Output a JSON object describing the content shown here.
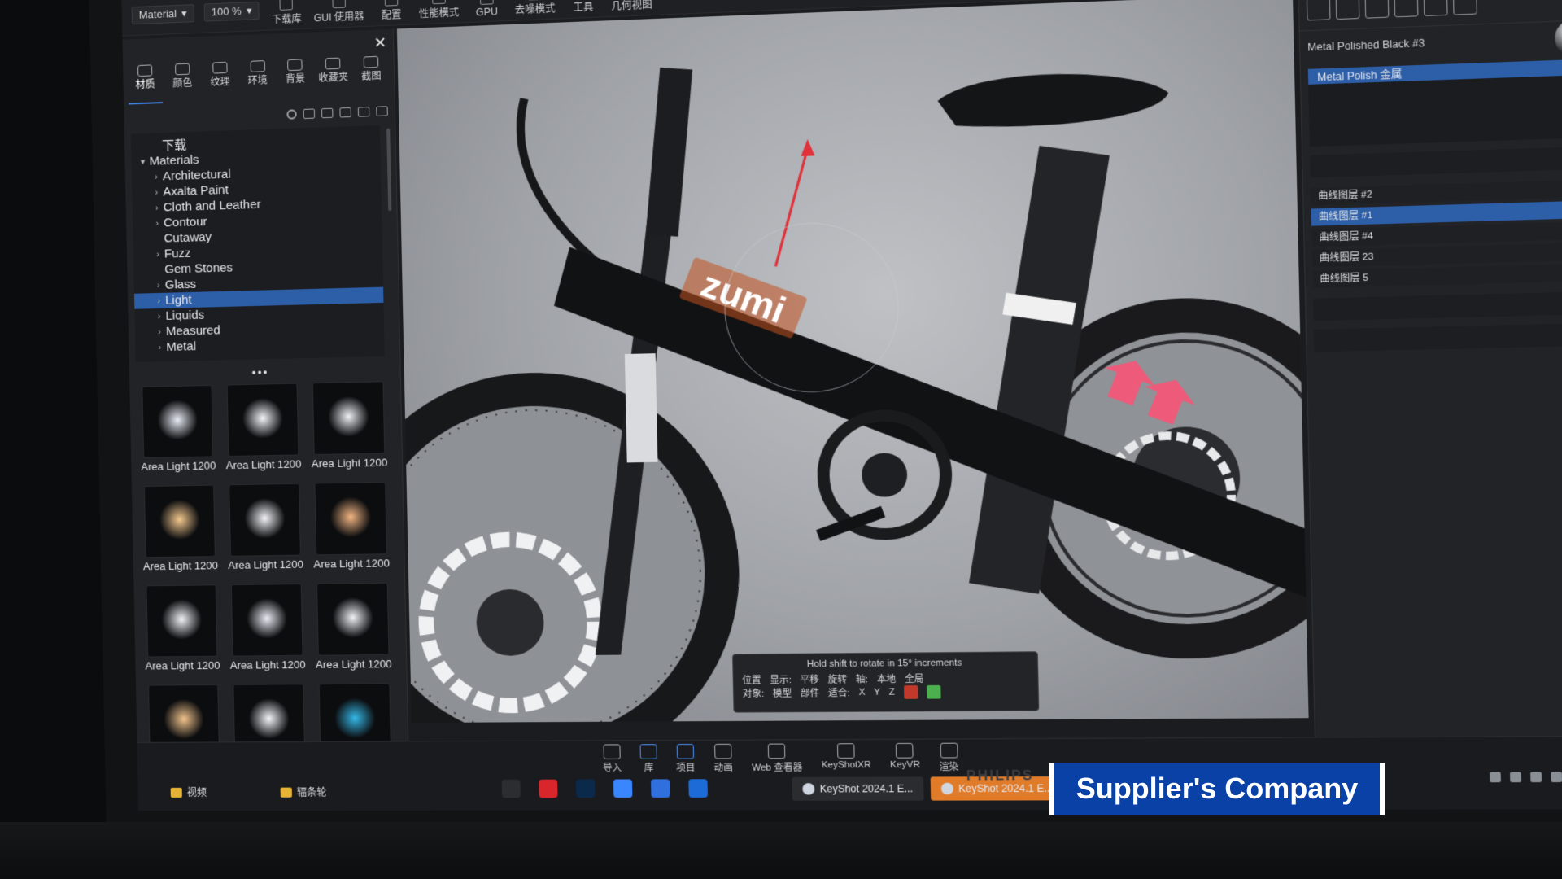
{
  "toolbar": {
    "material_select": "Material",
    "zoom_select": "100 %",
    "buttons": [
      "下载库",
      "GUI 使用器",
      "配置",
      "性能模式",
      "GPU",
      "去噪模式",
      "工具",
      "几何视图"
    ]
  },
  "library": {
    "tabs": [
      "材质",
      "颜色",
      "纹理",
      "环境",
      "背景",
      "收藏夹",
      "截图"
    ],
    "active_tab_index": 0,
    "tree": {
      "header": "下载",
      "root": "Materials",
      "items": [
        {
          "label": "Architectural",
          "chevron": true
        },
        {
          "label": "Axalta Paint",
          "chevron": true
        },
        {
          "label": "Cloth and Leather",
          "chevron": true
        },
        {
          "label": "Contour",
          "chevron": true
        },
        {
          "label": "Cutaway",
          "chevron": false
        },
        {
          "label": "Fuzz",
          "chevron": true
        },
        {
          "label": "Gem Stones",
          "chevron": false
        },
        {
          "label": "Glass",
          "chevron": true
        },
        {
          "label": "Light",
          "chevron": true,
          "selected": true
        },
        {
          "label": "Liquids",
          "chevron": true
        },
        {
          "label": "Measured",
          "chevron": true
        },
        {
          "label": "Metal",
          "chevron": true
        }
      ]
    },
    "more": "•••",
    "thumbnails": [
      {
        "label": "Area Light 1200 ...",
        "glow": "#e8ecf5"
      },
      {
        "label": "Area Light 1200 ...",
        "glow": "#f3f4f8"
      },
      {
        "label": "Area Light 1200 ...",
        "glow": "#eef0f6"
      },
      {
        "label": "Area Light 1200 ...",
        "glow": "#f4c98e"
      },
      {
        "label": "Area Light 1200 ...",
        "glow": "#f3f3f6"
      },
      {
        "label": "Area Light 1200 ...",
        "glow": "#f1b582"
      },
      {
        "label": "Area Light 1200 ...",
        "glow": "#f1f2f6"
      },
      {
        "label": "Area Light 1200 ...",
        "glow": "#e9ecf4"
      },
      {
        "label": "Area Light 1200 ...",
        "glow": "#f0f2f7"
      },
      {
        "label": "",
        "glow": "#f2c48c"
      },
      {
        "label": "",
        "glow": "#f4f5f8"
      },
      {
        "label": "",
        "glow": "#35b8e8"
      }
    ]
  },
  "viewport": {
    "frame_logo": "zumi",
    "gizmo_hint": "Hold shift to rotate in 15° increments",
    "gizmo_labels": [
      "位置",
      "显示:",
      "平移",
      "旋转",
      "轴:",
      "本地",
      "全局",
      "对象:",
      "模型",
      "部件",
      "适合:",
      "X",
      "Y",
      "Z"
    ]
  },
  "properties": {
    "material_name": "Metal Polished Black #3",
    "list_item_selected": "Metal Polish 金属",
    "layers": [
      "曲线图层 #2",
      "曲线图层 #1",
      "曲线图层 #4",
      "曲线图层 23",
      "曲线图层 5"
    ],
    "selected_layer_index": 1
  },
  "taskbar": {
    "dock": [
      {
        "label": "导入"
      },
      {
        "label": "库",
        "active": true
      },
      {
        "label": "项目",
        "active": true
      },
      {
        "label": "动画"
      },
      {
        "label": "Web 查看器"
      },
      {
        "label": "KeyShotXR"
      },
      {
        "label": "KeyVR"
      },
      {
        "label": "渲染"
      }
    ],
    "tasks": [
      {
        "label": "KeyShot 2024.1 E...",
        "hot": false
      },
      {
        "label": "KeyShot 2024.1 E...",
        "hot": true
      }
    ],
    "file_items": [
      "视频",
      "辐条轮"
    ],
    "pinned_icon_colors": [
      "#2b2d31",
      "#d8262b",
      "#0b2a4b",
      "#3a86ff",
      "#2f6fde",
      "#1c6bd6"
    ]
  },
  "monitor_brand": "PHILIPS",
  "caption": "Supplier's Company",
  "colors": {
    "accent_blue": "#2d5ea8",
    "caption_bg": "#0a41a6",
    "task_hot": "#e07b2a",
    "frame_pink": "#ee5b7a"
  }
}
